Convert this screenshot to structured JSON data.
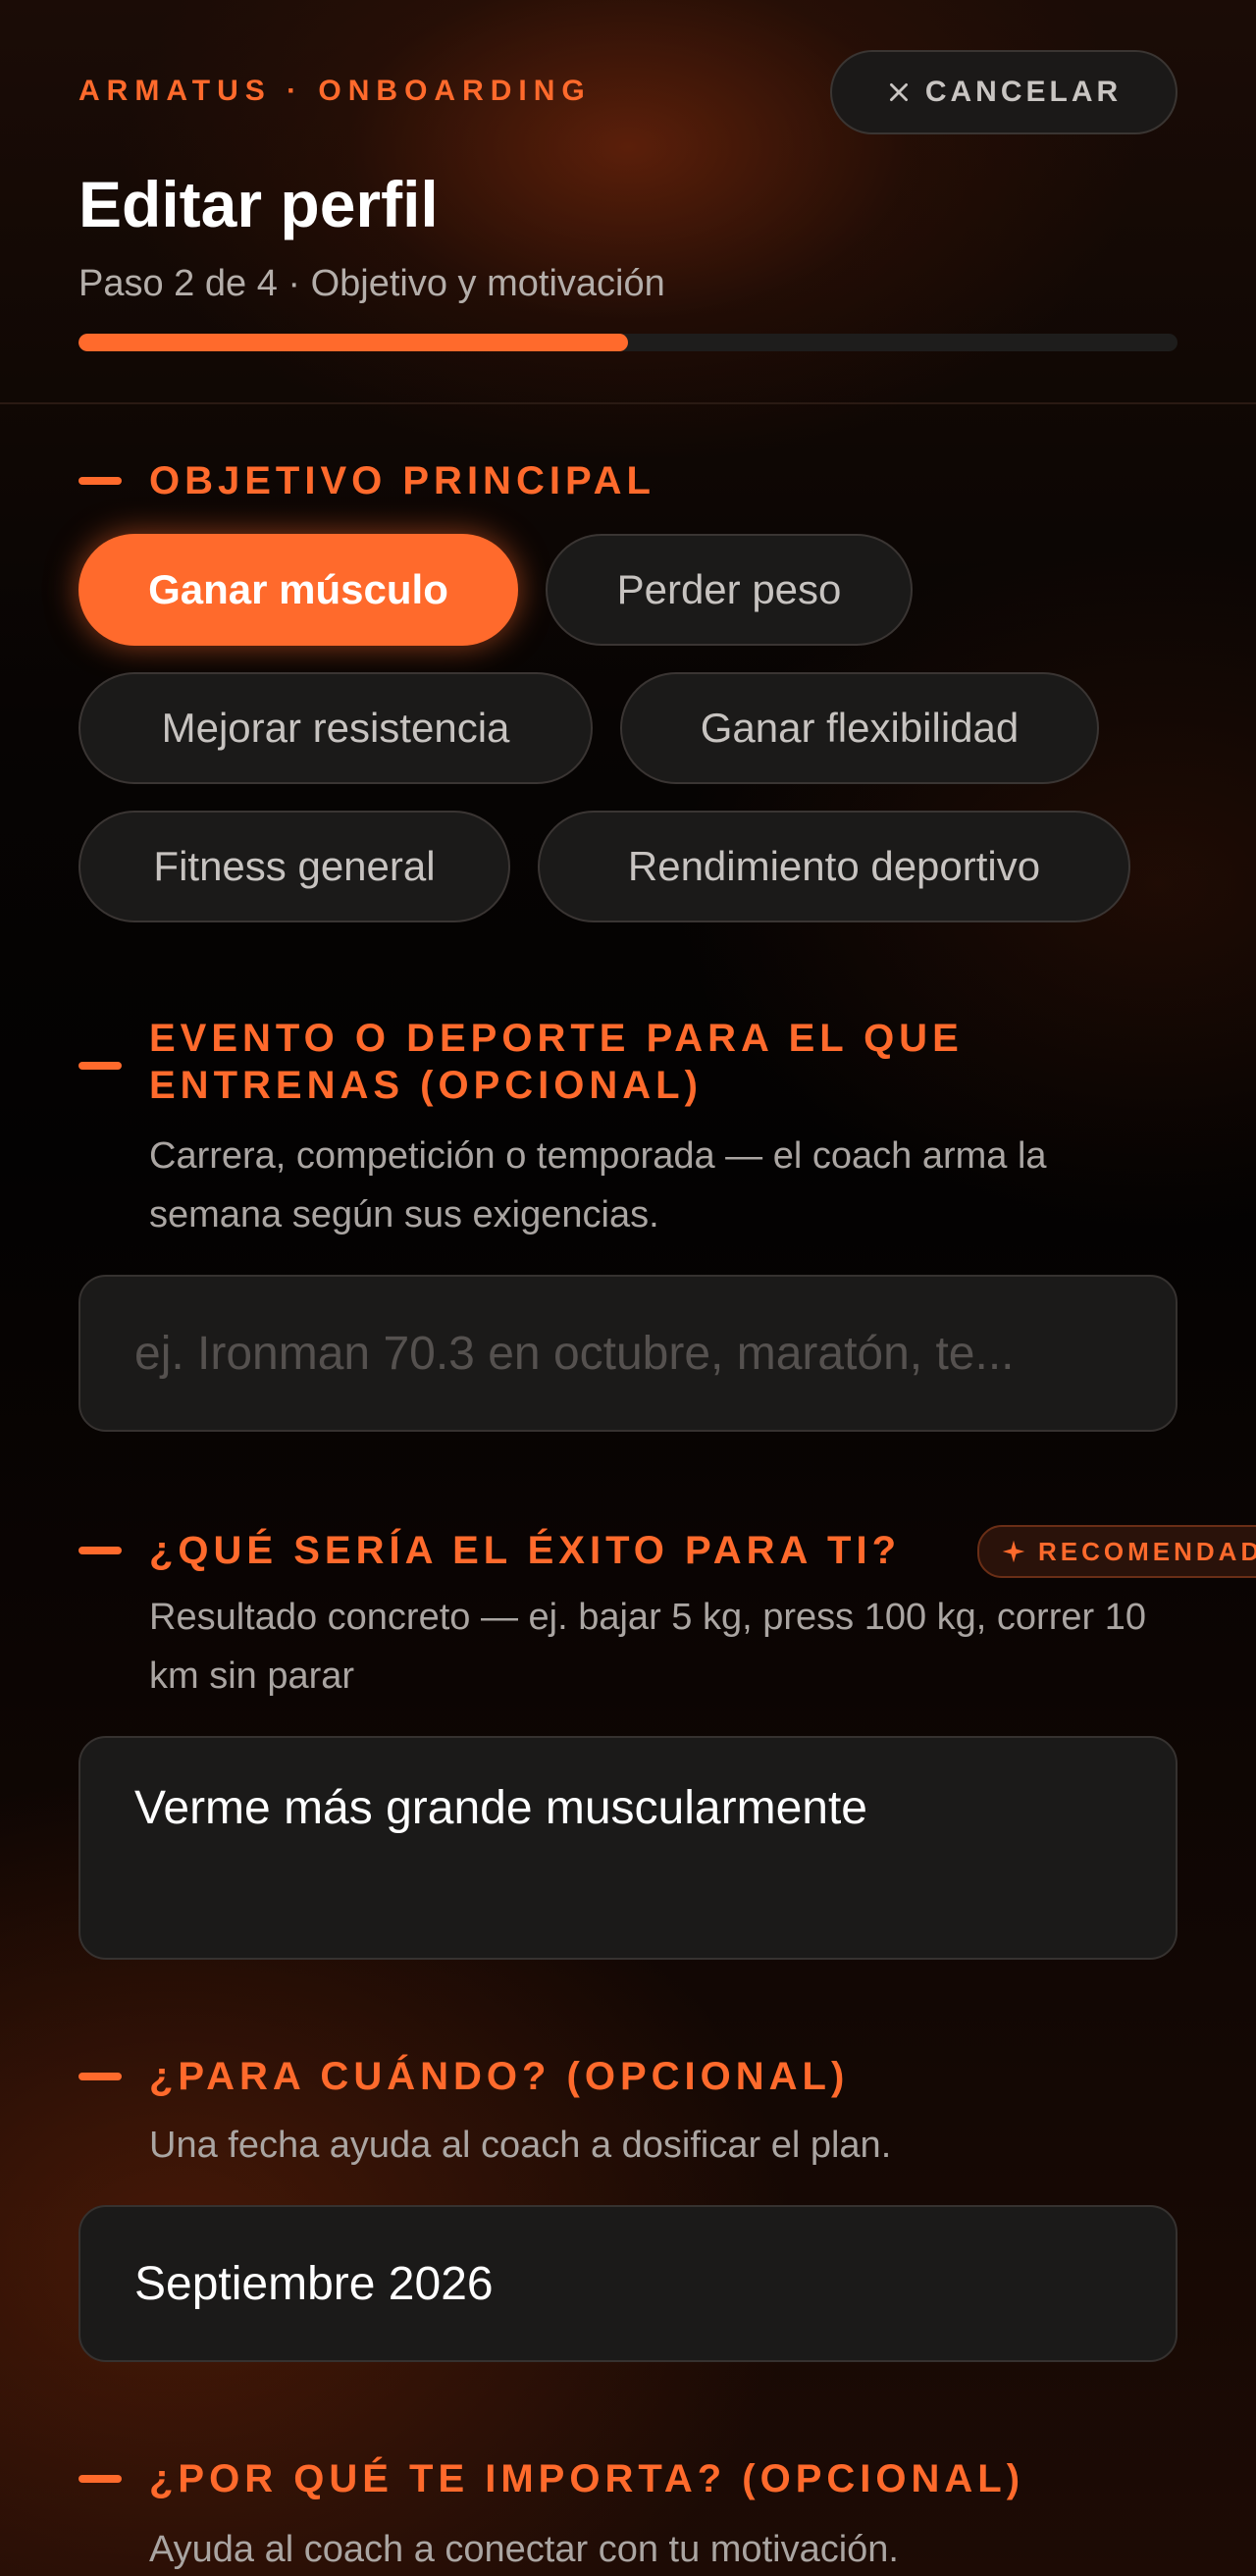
{
  "header": {
    "brand": "ARMATUS · ONBOARDING",
    "cancel_label": "CANCELAR",
    "title": "Editar perfil",
    "step": "Paso 2 de 4 · Objetivo y motivación",
    "progress": 0.5
  },
  "goal": {
    "label": "OBJETIVO PRINCIPAL",
    "options": [
      "Ganar músculo",
      "Perder peso",
      "Mejorar resistencia",
      "Ganar flexibilidad",
      "Fitness general",
      "Rendimiento deportivo"
    ],
    "selected": "Ganar músculo"
  },
  "event": {
    "label_line1": "EVENTO O DEPORTE PARA EL QUE",
    "label_line2": "ENTRENAS (OPCIONAL)",
    "helper": "Carrera, competición o temporada — el coach arma la semana según sus exigencias.",
    "placeholder": "ej. Ironman 70.3 en octubre, maratón, te..."
  },
  "success": {
    "label": "¿QUÉ SERÍA EL ÉXITO PARA TI?",
    "badge": "RECOMENDADO",
    "helper": "Resultado concreto — ej. bajar 5 kg, press 100 kg, correr 10 km sin parar",
    "value": "Verme más grande muscularmente"
  },
  "when": {
    "label": "¿PARA CUÁNDO? (OPCIONAL)",
    "helper": "Una fecha ayuda al coach a dosificar el plan.",
    "value": "Septiembre 2026"
  },
  "why": {
    "label": "¿POR QUÉ TE IMPORTA? (OPCIONAL)",
    "helper": "Ayuda al coach a conectar con tu motivación."
  },
  "colors": {
    "accent": "#ff6a2c",
    "background": "#050403",
    "surface": "#1b1a19"
  }
}
